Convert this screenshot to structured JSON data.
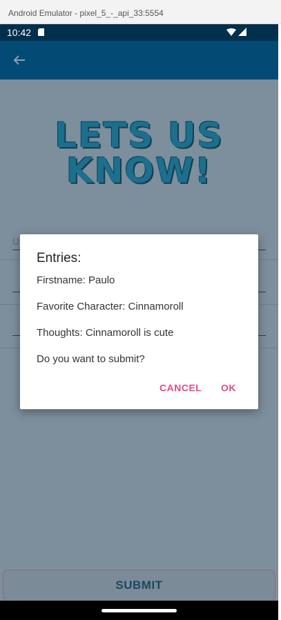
{
  "window": {
    "title": "Android Emulator - pixel_5_-_api_33:5554"
  },
  "status_bar": {
    "time": "10:42"
  },
  "page": {
    "hero_line1": "LETS US",
    "hero_line2": "KNOW!",
    "field1_label": "U",
    "submit_label": "SUBMIT"
  },
  "dialog": {
    "title": "Entries:",
    "firstname": "Firstname: Paulo",
    "favorite_character": "Favorite Character: Cinnamoroll",
    "thoughts": "Thoughts: Cinnamoroll is cute",
    "question": "Do you want to submit?",
    "cancel_label": "CANCEL",
    "ok_label": "OK"
  },
  "colors": {
    "status_bar": "#022f4c",
    "app_bar": "#034a74",
    "dialog_accent": "#e8468c"
  }
}
